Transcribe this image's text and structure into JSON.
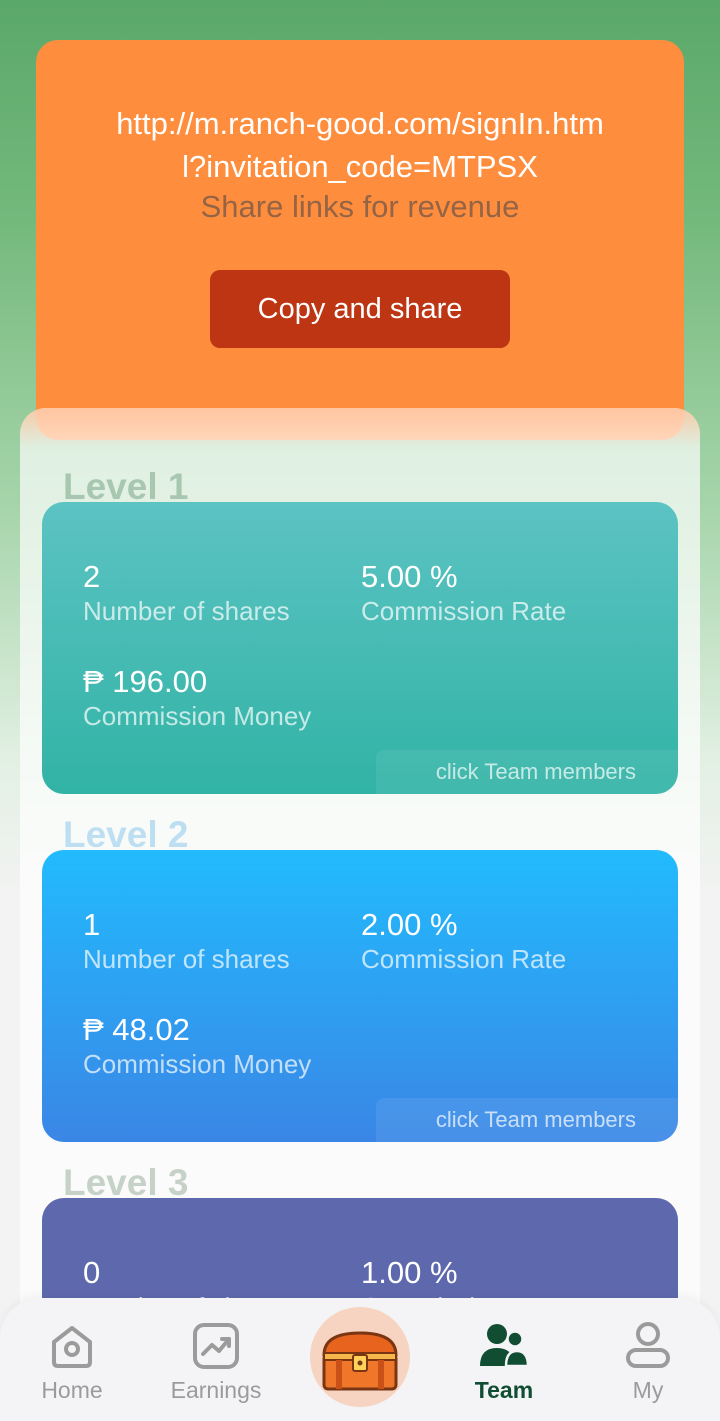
{
  "invite": {
    "link": "http://m.ranch-good.com/signIn.html?invitation_code=MTPSX",
    "subtitle": "Share links for revenue",
    "button_label": "Copy and share"
  },
  "levels": [
    {
      "title": "Level 1",
      "shares": "2",
      "shares_label": "Number of shares",
      "rate": "5.00 %",
      "rate_label": "Commission Rate",
      "money": "₱ 196.00",
      "money_label": "Commission Money",
      "team_link": "click Team members",
      "title_color": "#79a58a",
      "gradient": [
        "#5cc3c3",
        "#31b3a5"
      ]
    },
    {
      "title": "Level 2",
      "shares": "1",
      "shares_label": "Number of shares",
      "rate": "2.00 %",
      "rate_label": "Commission Rate",
      "money": "₱ 48.02",
      "money_label": "Commission Money",
      "team_link": "click Team members",
      "title_color": "#8ec7ec",
      "gradient": [
        "#22bbfd",
        "#3a86e6"
      ]
    },
    {
      "title": "Level 3",
      "shares": "0",
      "shares_label": "Number of shares",
      "rate": "1.00 %",
      "rate_label": "Commission Rate",
      "title_color": "#9bb29f",
      "gradient": [
        "#5e69ad",
        "#5e69ad"
      ]
    }
  ],
  "nav": {
    "items": [
      {
        "label": "Home",
        "icon": "home-icon"
      },
      {
        "label": "Earnings",
        "icon": "earnings-icon"
      },
      {
        "label": "",
        "icon": "treasure-chest-icon"
      },
      {
        "label": "Team",
        "icon": "team-icon",
        "active": true
      },
      {
        "label": "My",
        "icon": "profile-icon"
      }
    ]
  },
  "colors": {
    "invite_card": "#fe8d3d",
    "copy_button": "#bd3512",
    "nav_active": "#104d33"
  }
}
